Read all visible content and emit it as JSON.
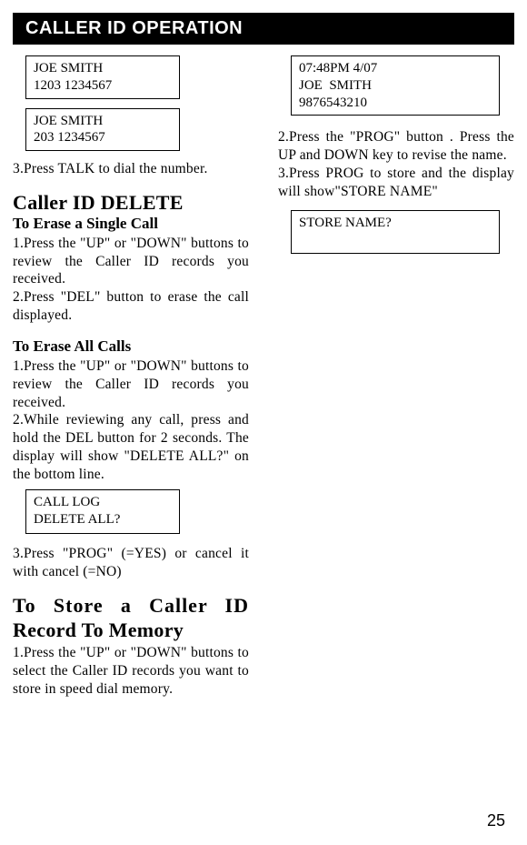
{
  "header": "CALLER ID OPERATION",
  "left": {
    "box1": {
      "line1": "JOE SMITH",
      "line2": "1203 1234567"
    },
    "box2": {
      "line1": "JOE SMITH",
      "line2": "203 1234567"
    },
    "step3": "3.Press TALK  to dial the number.",
    "deleteTitle": "Caller ID DELETE",
    "eraseSingleTitle": "To Erase a Single Call",
    "eraseSingleBody": "1.Press the \"UP\" or \"DOWN\" buttons to review the Caller ID records you received.\n2.Press \"DEL\" button to erase the call displayed.",
    "eraseAllTitle": "To Erase All Calls",
    "eraseAllBody": "1.Press the \"UP\" or \"DOWN\" buttons to review  the Caller ID records you received.\n2.While reviewing any call, press and hold the DEL button for 2 seconds. The display will show \"DELETE ALL?\" on the bottom line.",
    "box3": {
      "line1": "CALL LOG",
      "line2": "DELETE ALL?"
    },
    "eraseAllStep3": "3.Press \"PROG\" (=YES) or cancel it with cancel (=NO)",
    "storeTitle1": "To Store a Caller ID",
    "storeTitle2": "Record To Memory",
    "storeBody": "1.Press the \"UP\" or \"DOWN\" buttons to select the Caller ID records you want to store in speed dial memory."
  },
  "right": {
    "box1": {
      "line1": "07:48PM 4/07",
      "line2": "JOE  SMITH",
      "line3": "9876543210"
    },
    "storeStep2": "2.Press the \"PROG\" button . Press the UP and DOWN key to revise the name.\n3.Press PROG to store and the display will show\"STORE NAME\"",
    "box2": {
      "line1": "STORE NAME?",
      "line2": " "
    }
  },
  "pageNumber": "25"
}
